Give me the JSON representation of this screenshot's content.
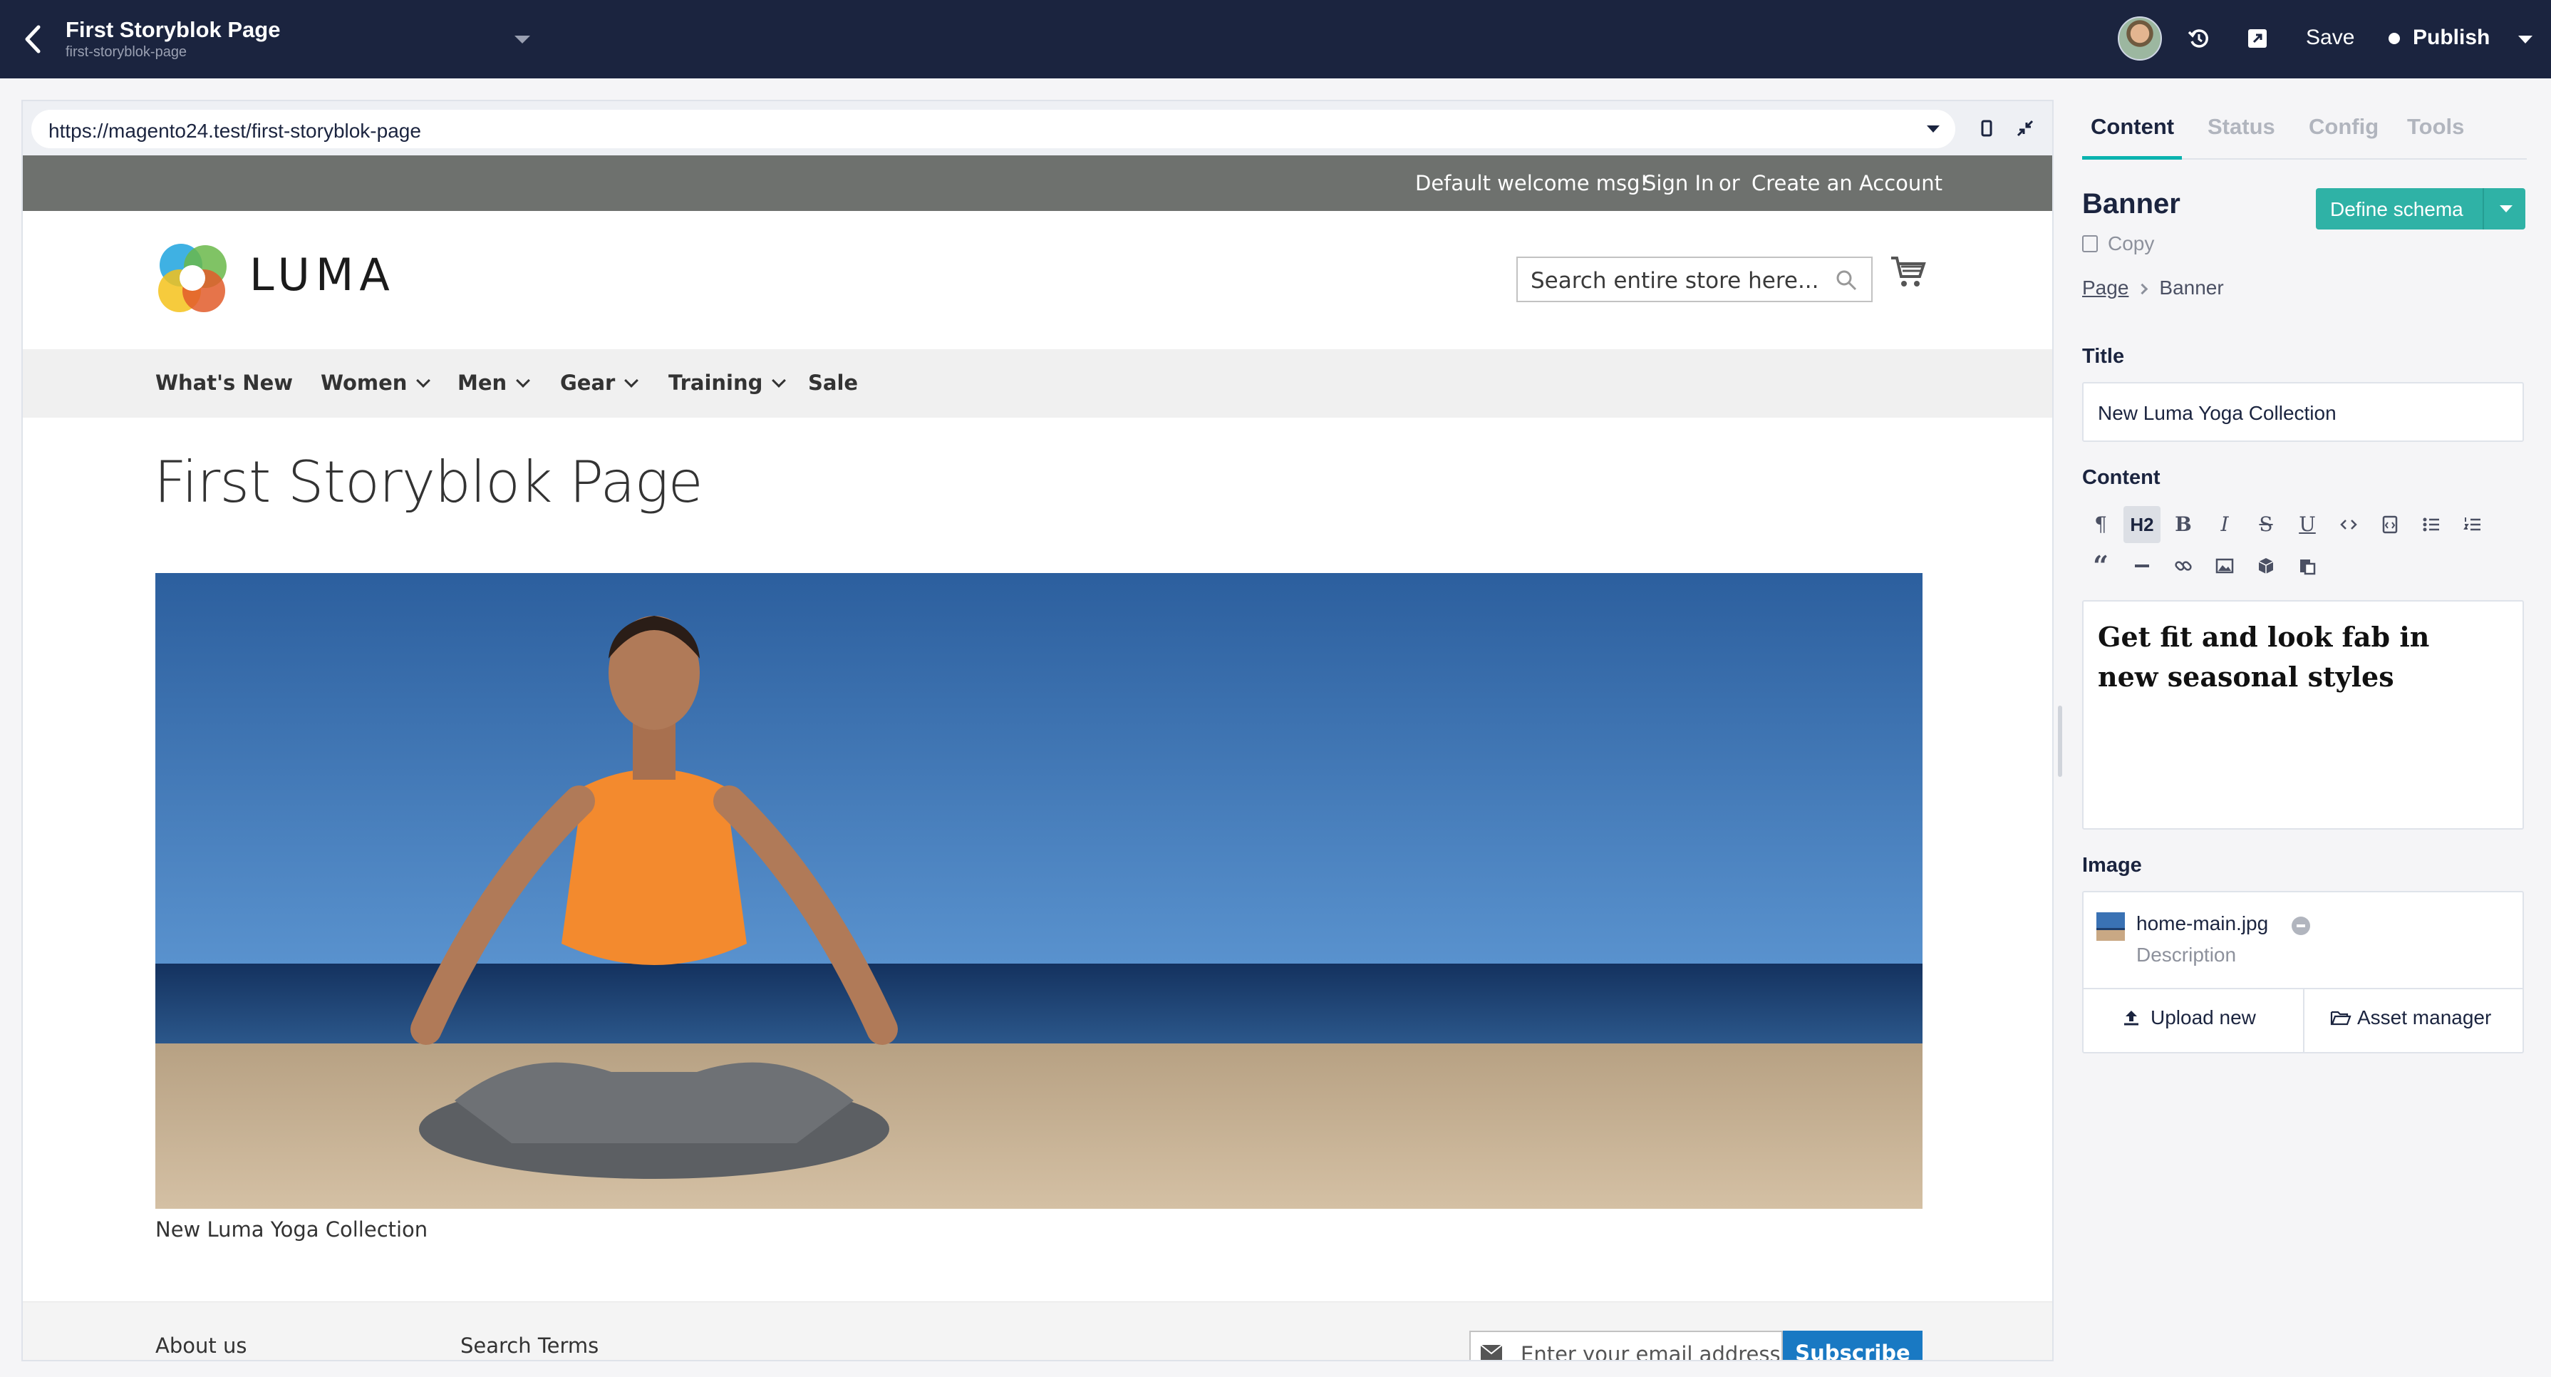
{
  "topbar": {
    "title": "First Storyblok Page",
    "slug": "first-storyblok-page",
    "save_label": "Save",
    "publish_label": "Publish"
  },
  "preview": {
    "url": "https://magento24.test/first-storyblok-page",
    "site": {
      "welcome": "Default welcome msg!",
      "sign_in": "Sign In",
      "or": "or",
      "create_account": "Create an Account",
      "logo_text": "LUMA",
      "search_placeholder": "Search entire store here...",
      "nav": [
        "What's New",
        "Women",
        "Men",
        "Gear",
        "Training",
        "Sale"
      ],
      "page_title": "First Storyblok Page",
      "banner_caption": "New Luma Yoga Collection",
      "footer_links": [
        "About us",
        "Search Terms"
      ],
      "newsletter_placeholder": "Enter your email address",
      "subscribe_label": "Subscribe"
    }
  },
  "panel": {
    "tabs": [
      "Content",
      "Status",
      "Config",
      "Tools"
    ],
    "active_tab": "Content",
    "block_name": "Banner",
    "copy_label": "Copy",
    "define_schema_label": "Define schema",
    "breadcrumb": [
      "Page",
      "Banner"
    ],
    "title_label": "Title",
    "title_value": "New Luma Yoga Collection",
    "content_label": "Content",
    "content_value": "Get fit and look fab in new seasonal styles",
    "rt_h2": "H2",
    "image_label": "Image",
    "image_file": "home-main.jpg",
    "image_description": "Description",
    "upload_label": "Upload new",
    "asset_manager_label": "Asset manager"
  },
  "colors": {
    "topbar": "#1b243f",
    "accent": "#09b3af",
    "define_schema": "#2fb2a6",
    "subscribe": "#1979c3",
    "panel_bar": "#6e716e"
  }
}
